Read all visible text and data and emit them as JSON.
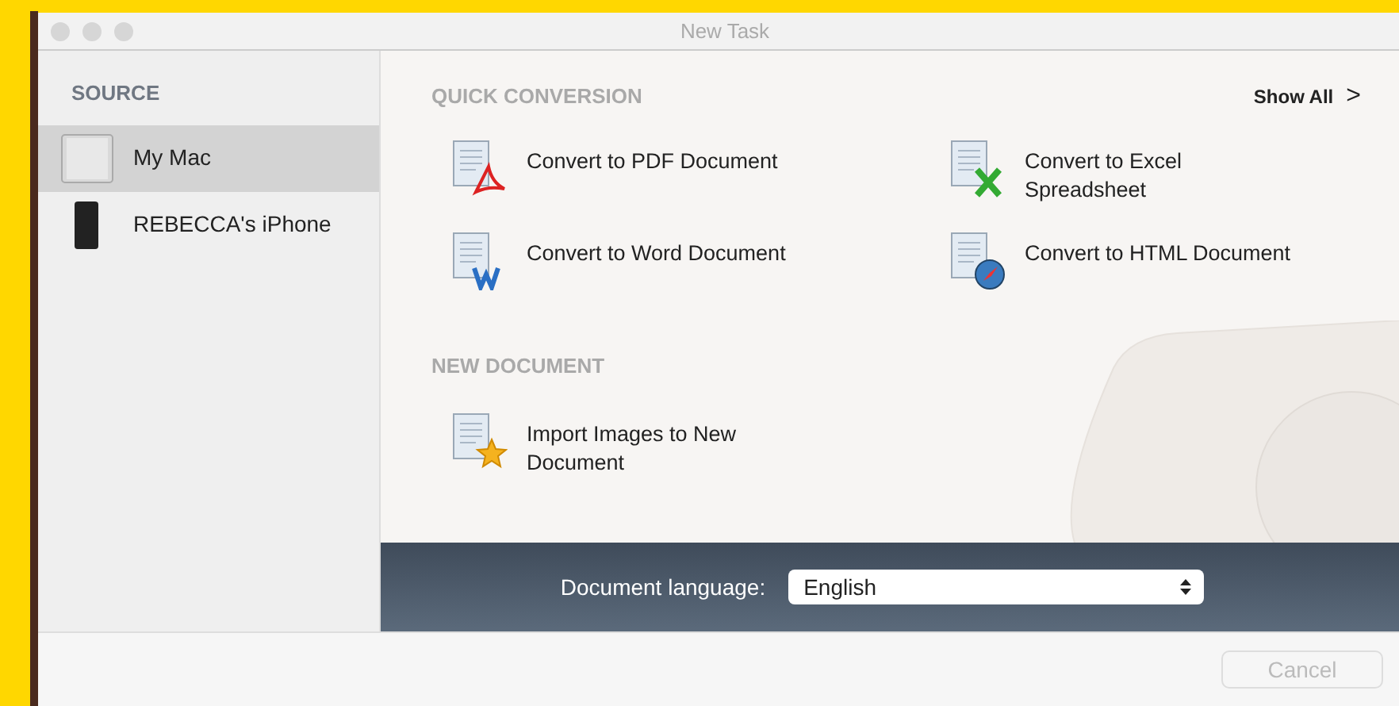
{
  "window": {
    "title": "New Task"
  },
  "sidebar": {
    "heading": "SOURCE",
    "items": [
      {
        "label": "My Mac",
        "kind": "computer",
        "selected": true
      },
      {
        "label": "REBECCA's iPhone",
        "kind": "phone",
        "selected": false
      }
    ]
  },
  "quick_conversion": {
    "heading": "QUICK CONVERSION",
    "show_all": "Show All",
    "show_all_icon": ">",
    "items": [
      {
        "label": "Convert to PDF Document",
        "kind": "pdf"
      },
      {
        "label": "Convert to Excel Spreadsheet",
        "kind": "excel"
      },
      {
        "label": "Convert to Word Document",
        "kind": "word"
      },
      {
        "label": "Convert to HTML Document",
        "kind": "html"
      }
    ]
  },
  "new_document": {
    "heading": "NEW DOCUMENT",
    "items": [
      {
        "label": "Import Images to New Document",
        "kind": "images"
      }
    ]
  },
  "language_bar": {
    "label": "Document language:",
    "value": "English"
  },
  "footer": {
    "cancel": {
      "label": "Cancel",
      "disabled": true
    }
  }
}
